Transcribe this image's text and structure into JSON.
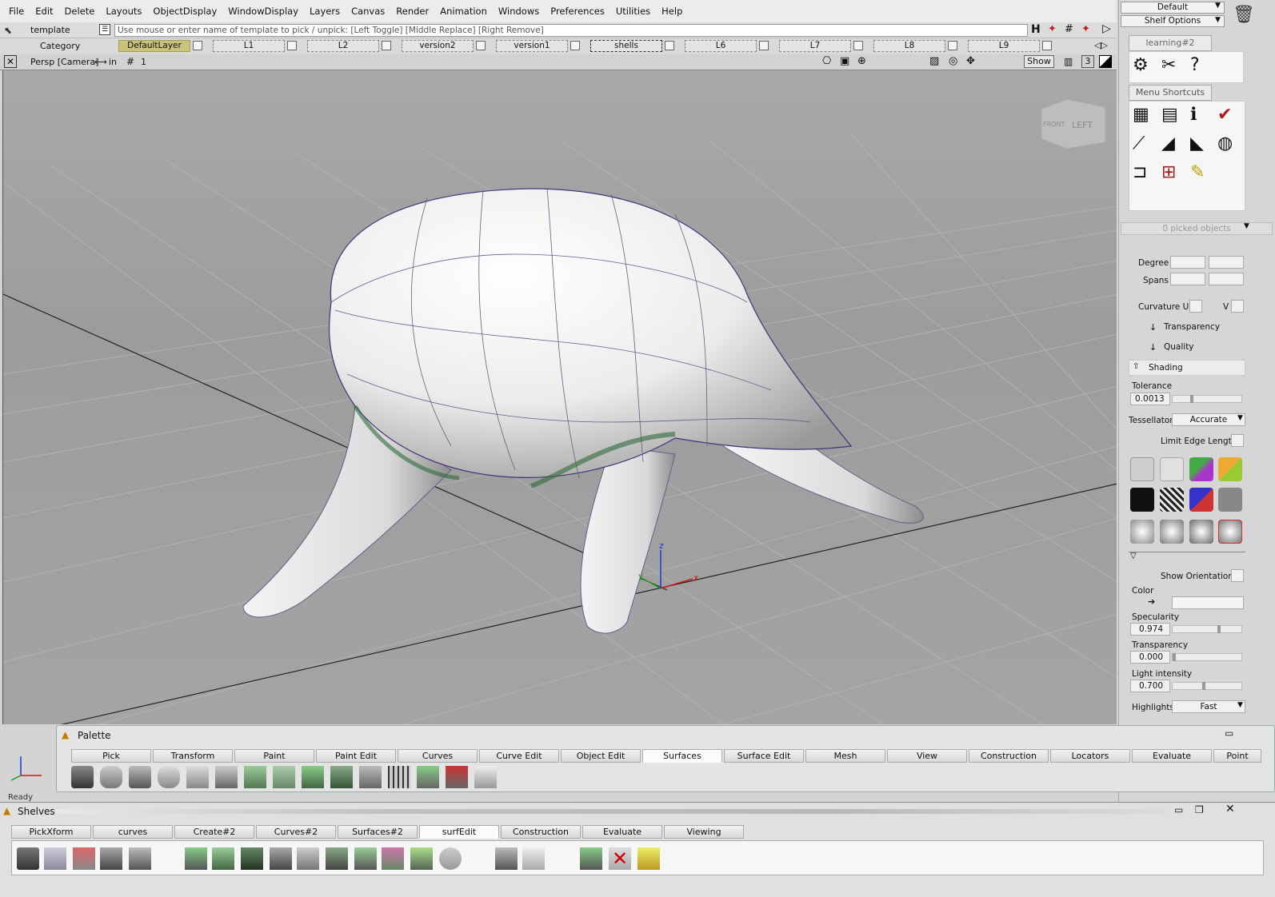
{
  "menubar": {
    "items": [
      "File",
      "Edit",
      "Delete",
      "Layouts",
      "ObjectDisplay",
      "WindowDisplay",
      "Layers",
      "Canvas",
      "Render",
      "Animation",
      "Windows",
      "Preferences",
      "Utilities",
      "Help"
    ]
  },
  "template": {
    "name": "template",
    "hint": "Use mouse or enter name of template to pick / unpick: [Left Toggle] [Middle Replace] [Right Remove]"
  },
  "layers": {
    "category": "Category",
    "items": [
      "DefaultLayer",
      "L1",
      "L2",
      "version2",
      "version1",
      "shells",
      "L6",
      "L7",
      "L8",
      "L9"
    ]
  },
  "viewport": {
    "camera": "Persp [Camera]",
    "units": "in",
    "grid_count": "1",
    "show_label": "Show",
    "view_number": "3",
    "cube_left": "LEFT",
    "cube_front": "FRONT",
    "axis_z": "z",
    "axis_y": "y",
    "axis_x": "x"
  },
  "right_panel": {
    "preset": "Default",
    "shelf_options": "Shelf Options",
    "shelf_tab": "learning#2",
    "menu_shortcuts": "Menu Shortcuts",
    "picked": "0 picked objects",
    "degree": "Degree",
    "spans": "Spans",
    "curvature_u": "Curvature U",
    "curvature_v": "V",
    "transparency_section": "Transparency",
    "quality_section": "Quality",
    "shading_section": "Shading",
    "tolerance_label": "Tolerance",
    "tolerance_value": "0.0013",
    "tessellator_label": "Tessellator",
    "tessellator_value": "Accurate",
    "limit_edge": "Limit Edge Length",
    "show_orientation": "Show Orientation",
    "color_label": "Color",
    "specularity_label": "Specularity",
    "specularity_value": "0.974",
    "transparency_label": "Transparency",
    "transparency_value": "0.000",
    "light_label": "Light intensity",
    "light_value": "0.700",
    "highlights_label": "Highlights",
    "highlights_value": "Fast"
  },
  "palette": {
    "title": "Palette",
    "tabs": [
      "Pick",
      "Transform",
      "Paint",
      "Paint Edit",
      "Curves",
      "Curve Edit",
      "Object Edit",
      "Surfaces",
      "Surface Edit",
      "Mesh",
      "View",
      "Construction",
      "Locators",
      "Evaluate",
      "Point"
    ],
    "active_tab": "Surfaces"
  },
  "status": "Ready",
  "shelves": {
    "title": "Shelves",
    "tabs": [
      "PickXform",
      "curves",
      "Create#2",
      "Curves#2",
      "Surfaces#2",
      "surfEdit",
      "Construction",
      "Evaluate",
      "Viewing"
    ],
    "active_tab": "surfEdit"
  },
  "colors": {
    "viewport_bg": "#a3a3a3",
    "grid": "#b4b4b4",
    "curve_purple": "#4a2f7a",
    "highlight_layer": "#c8c27a"
  }
}
